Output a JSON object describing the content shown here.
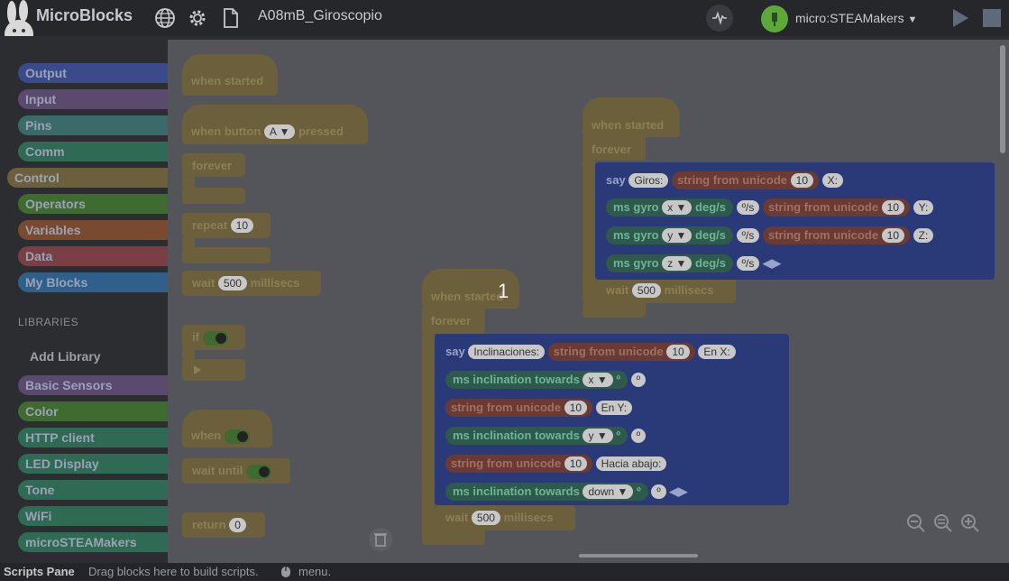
{
  "app": {
    "name": "MicroBlocks",
    "project_name": "A08mB_Giroscopio",
    "board_name": "micro:STEAMakers",
    "board_menu_arrow": "▼"
  },
  "toolbar_icons": [
    "globe-icon",
    "gear-icon",
    "file-icon",
    "graph-icon",
    "usb-icon",
    "run-icon",
    "stop-icon"
  ],
  "palette": {
    "categories": [
      {
        "label": "Output",
        "color": "#3a4a8a"
      },
      {
        "label": "Input",
        "color": "#5a4a6e"
      },
      {
        "label": "Pins",
        "color": "#3a6a6a"
      },
      {
        "label": "Comm",
        "color": "#2f6a55"
      },
      {
        "label": "Control",
        "color": "#6b5f3c"
      },
      {
        "label": "Operators",
        "color": "#3f6a30"
      },
      {
        "label": "Variables",
        "color": "#7a4a30"
      },
      {
        "label": "Data",
        "color": "#7a3f45"
      },
      {
        "label": "My Blocks",
        "color": "#2f5f8a"
      }
    ],
    "libraries_header": "LIBRARIES",
    "add_library": "Add Library",
    "libraries": [
      {
        "label": "Basic Sensors",
        "color": "#5a4a6e"
      },
      {
        "label": "Color",
        "color": "#3f6a30"
      },
      {
        "label": "HTTP client",
        "color": "#2f6a55"
      },
      {
        "label": "LED Display",
        "color": "#2f6a55"
      },
      {
        "label": "Tone",
        "color": "#2f6a55"
      },
      {
        "label": "WiFi",
        "color": "#2f6a55"
      },
      {
        "label": "microSTEAMakers",
        "color": "#2f6a55"
      }
    ]
  },
  "palette_blocks": {
    "when_started": "when started",
    "when_button": "when button",
    "button_value": "A",
    "dropdown_arrow": "▼",
    "pressed": "pressed",
    "forever": "forever",
    "repeat": "repeat",
    "repeat_value": "10",
    "wait": "wait",
    "wait_value": "500",
    "millisecs": "millisecs",
    "if": "if",
    "when": "when",
    "wait_until": "wait until",
    "return": "return",
    "return_value": "0"
  },
  "script1": {
    "hat": "when started",
    "forever": "forever",
    "say": "say",
    "giros": "Giros:",
    "string_from_unicode": "string from unicode",
    "code": "10",
    "x_label": "X:",
    "y_label": "Y:",
    "z_label": "Z:",
    "ms_gyro": "ms gyro",
    "deg_s": "deg/s",
    "unit": "º/s",
    "axes": [
      "x",
      "y",
      "z"
    ],
    "wait": "wait",
    "wait_value": "500",
    "millisecs": "millisecs"
  },
  "script2": {
    "hat": "when started",
    "count_badge": "1",
    "forever": "forever",
    "say": "say",
    "inclinaciones": "Inclinaciones:",
    "string_from_unicode": "string from unicode",
    "code": "10",
    "en_x": "En X:",
    "en_y": "En Y:",
    "hacia_abajo": "Hacia abajo:",
    "ms_inclination": "ms inclination towards",
    "directions": [
      "x",
      "y",
      "down"
    ],
    "degree": "º",
    "wait": "wait",
    "wait_value": "500",
    "millisecs": "millisecs"
  },
  "footer": {
    "title": "Scripts Pane",
    "hint": "Drag blocks here to build scripts.",
    "menu": "menu."
  }
}
